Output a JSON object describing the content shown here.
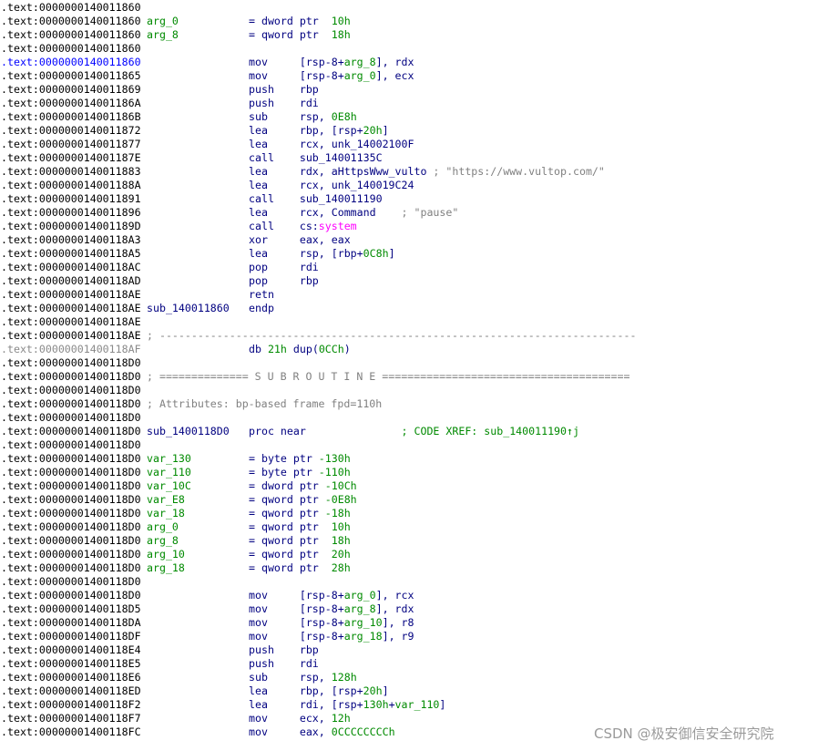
{
  "colors": {
    "x": "#000000",
    "b": "#0000ff",
    "g": "#8a8a8a",
    "k": "#000080",
    "n": "#008a00",
    "c": "#808080",
    "m": "#ff00ff"
  },
  "lines": [
    {
      "a": ".text:0000000140011860",
      "ac": "x",
      "label": [],
      "code": []
    },
    {
      "a": ".text:0000000140011860",
      "ac": "x",
      "label": [
        [
          "arg_0",
          "n"
        ]
      ],
      "code": [
        [
          "= dword ptr  ",
          "k"
        ],
        [
          "10h",
          "n"
        ]
      ]
    },
    {
      "a": ".text:0000000140011860",
      "ac": "x",
      "label": [
        [
          "arg_8",
          "n"
        ]
      ],
      "code": [
        [
          "= qword ptr  ",
          "k"
        ],
        [
          "18h",
          "n"
        ]
      ]
    },
    {
      "a": ".text:0000000140011860",
      "ac": "x",
      "label": [],
      "code": []
    },
    {
      "a": ".text:0000000140011860",
      "ac": "b",
      "label": [],
      "code": [
        [
          "mov     [rsp-8+",
          "k"
        ],
        [
          "arg_8",
          "n"
        ],
        [
          "], rdx",
          "k"
        ]
      ]
    },
    {
      "a": ".text:0000000140011865",
      "ac": "x",
      "label": [],
      "code": [
        [
          "mov     [rsp-8+",
          "k"
        ],
        [
          "arg_0",
          "n"
        ],
        [
          "], ecx",
          "k"
        ]
      ]
    },
    {
      "a": ".text:0000000140011869",
      "ac": "x",
      "label": [],
      "code": [
        [
          "push    rbp",
          "k"
        ]
      ]
    },
    {
      "a": ".text:000000014001186A",
      "ac": "x",
      "label": [],
      "code": [
        [
          "push    rdi",
          "k"
        ]
      ]
    },
    {
      "a": ".text:000000014001186B",
      "ac": "x",
      "label": [],
      "code": [
        [
          "sub     rsp, ",
          "k"
        ],
        [
          "0E8h",
          "n"
        ]
      ]
    },
    {
      "a": ".text:0000000140011872",
      "ac": "x",
      "label": [],
      "code": [
        [
          "lea     rbp, [rsp+",
          "k"
        ],
        [
          "20h",
          "n"
        ],
        [
          "]",
          "k"
        ]
      ]
    },
    {
      "a": ".text:0000000140011877",
      "ac": "x",
      "label": [],
      "code": [
        [
          "lea     rcx, unk_14002100F",
          "k"
        ]
      ]
    },
    {
      "a": ".text:000000014001187E",
      "ac": "x",
      "label": [],
      "code": [
        [
          "call    sub_14001135C",
          "k"
        ]
      ]
    },
    {
      "a": ".text:0000000140011883",
      "ac": "x",
      "label": [],
      "code": [
        [
          "lea     rdx, aHttpsWww_vulto ",
          "k"
        ],
        [
          "; \"https://www.vultop.com/\"",
          "c"
        ]
      ]
    },
    {
      "a": ".text:000000014001188A",
      "ac": "x",
      "label": [],
      "code": [
        [
          "lea     rcx, unk_140019C24",
          "k"
        ]
      ]
    },
    {
      "a": ".text:0000000140011891",
      "ac": "x",
      "label": [],
      "code": [
        [
          "call    sub_140011190",
          "k"
        ]
      ]
    },
    {
      "a": ".text:0000000140011896",
      "ac": "x",
      "label": [],
      "code": [
        [
          "lea     rcx, Command    ",
          "k"
        ],
        [
          "; \"pause\"",
          "c"
        ]
      ]
    },
    {
      "a": ".text:000000014001189D",
      "ac": "x",
      "label": [],
      "code": [
        [
          "call    cs:",
          "k"
        ],
        [
          "system",
          "m"
        ]
      ]
    },
    {
      "a": ".text:00000001400118A3",
      "ac": "x",
      "label": [],
      "code": [
        [
          "xor     eax, eax",
          "k"
        ]
      ]
    },
    {
      "a": ".text:00000001400118A5",
      "ac": "x",
      "label": [],
      "code": [
        [
          "lea     rsp, [rbp+",
          "k"
        ],
        [
          "0C8h",
          "n"
        ],
        [
          "]",
          "k"
        ]
      ]
    },
    {
      "a": ".text:00000001400118AC",
      "ac": "x",
      "label": [],
      "code": [
        [
          "pop     rdi",
          "k"
        ]
      ]
    },
    {
      "a": ".text:00000001400118AD",
      "ac": "x",
      "label": [],
      "code": [
        [
          "pop     rbp",
          "k"
        ]
      ]
    },
    {
      "a": ".text:00000001400118AE",
      "ac": "x",
      "label": [],
      "code": [
        [
          "retn",
          "k"
        ]
      ]
    },
    {
      "a": ".text:00000001400118AE",
      "ac": "x",
      "label": [
        [
          "sub_140011860",
          "k"
        ]
      ],
      "code": [
        [
          "endp",
          "k"
        ]
      ]
    },
    {
      "a": ".text:00000001400118AE",
      "ac": "x",
      "label": [],
      "code": []
    },
    {
      "a": ".text:00000001400118AE",
      "ac": "x",
      "label": [
        [
          "; ---------------------------------------------------------------------------",
          "c"
        ]
      ],
      "code": []
    },
    {
      "a": ".text:00000001400118AF",
      "ac": "g",
      "label": [],
      "code": [
        [
          "db ",
          "k"
        ],
        [
          "21h",
          "n"
        ],
        [
          " dup(",
          "k"
        ],
        [
          "0CCh",
          "n"
        ],
        [
          ")",
          "k"
        ]
      ]
    },
    {
      "a": ".text:00000001400118D0",
      "ac": "x",
      "label": [],
      "code": []
    },
    {
      "a": ".text:00000001400118D0",
      "ac": "x",
      "label": [
        [
          "; ============== S U B R O U T I N E =======================================",
          "c"
        ]
      ],
      "code": []
    },
    {
      "a": ".text:00000001400118D0",
      "ac": "x",
      "label": [],
      "code": []
    },
    {
      "a": ".text:00000001400118D0",
      "ac": "x",
      "label": [
        [
          "; Attributes: bp-based frame fpd=110h",
          "c"
        ]
      ],
      "code": []
    },
    {
      "a": ".text:00000001400118D0",
      "ac": "x",
      "label": [],
      "code": []
    },
    {
      "a": ".text:00000001400118D0",
      "ac": "x",
      "label": [
        [
          "sub_1400118D0",
          "k"
        ]
      ],
      "code": [
        [
          "proc near               ",
          "k"
        ],
        [
          "; CODE XREF: sub_140011190↑j",
          "n"
        ]
      ]
    },
    {
      "a": ".text:00000001400118D0",
      "ac": "x",
      "label": [],
      "code": []
    },
    {
      "a": ".text:00000001400118D0",
      "ac": "x",
      "label": [
        [
          "var_130",
          "n"
        ]
      ],
      "code": [
        [
          "= byte ptr ",
          "k"
        ],
        [
          "-130h",
          "n"
        ]
      ]
    },
    {
      "a": ".text:00000001400118D0",
      "ac": "x",
      "label": [
        [
          "var_110",
          "n"
        ]
      ],
      "code": [
        [
          "= byte ptr ",
          "k"
        ],
        [
          "-110h",
          "n"
        ]
      ]
    },
    {
      "a": ".text:00000001400118D0",
      "ac": "x",
      "label": [
        [
          "var_10C",
          "n"
        ]
      ],
      "code": [
        [
          "= dword ptr ",
          "k"
        ],
        [
          "-10Ch",
          "n"
        ]
      ]
    },
    {
      "a": ".text:00000001400118D0",
      "ac": "x",
      "label": [
        [
          "var_E8",
          "n"
        ]
      ],
      "code": [
        [
          "= qword ptr ",
          "k"
        ],
        [
          "-0E8h",
          "n"
        ]
      ]
    },
    {
      "a": ".text:00000001400118D0",
      "ac": "x",
      "label": [
        [
          "var_18",
          "n"
        ]
      ],
      "code": [
        [
          "= qword ptr ",
          "k"
        ],
        [
          "-18h",
          "n"
        ]
      ]
    },
    {
      "a": ".text:00000001400118D0",
      "ac": "x",
      "label": [
        [
          "arg_0",
          "n"
        ]
      ],
      "code": [
        [
          "= qword ptr  ",
          "k"
        ],
        [
          "10h",
          "n"
        ]
      ]
    },
    {
      "a": ".text:00000001400118D0",
      "ac": "x",
      "label": [
        [
          "arg_8",
          "n"
        ]
      ],
      "code": [
        [
          "= qword ptr  ",
          "k"
        ],
        [
          "18h",
          "n"
        ]
      ]
    },
    {
      "a": ".text:00000001400118D0",
      "ac": "x",
      "label": [
        [
          "arg_10",
          "n"
        ]
      ],
      "code": [
        [
          "= qword ptr  ",
          "k"
        ],
        [
          "20h",
          "n"
        ]
      ]
    },
    {
      "a": ".text:00000001400118D0",
      "ac": "x",
      "label": [
        [
          "arg_18",
          "n"
        ]
      ],
      "code": [
        [
          "= qword ptr  ",
          "k"
        ],
        [
          "28h",
          "n"
        ]
      ]
    },
    {
      "a": ".text:00000001400118D0",
      "ac": "x",
      "label": [],
      "code": []
    },
    {
      "a": ".text:00000001400118D0",
      "ac": "x",
      "label": [],
      "code": [
        [
          "mov     [rsp-8+",
          "k"
        ],
        [
          "arg_0",
          "n"
        ],
        [
          "], rcx",
          "k"
        ]
      ]
    },
    {
      "a": ".text:00000001400118D5",
      "ac": "x",
      "label": [],
      "code": [
        [
          "mov     [rsp-8+",
          "k"
        ],
        [
          "arg_8",
          "n"
        ],
        [
          "], rdx",
          "k"
        ]
      ]
    },
    {
      "a": ".text:00000001400118DA",
      "ac": "x",
      "label": [],
      "code": [
        [
          "mov     [rsp-8+",
          "k"
        ],
        [
          "arg_10",
          "n"
        ],
        [
          "], r8",
          "k"
        ]
      ]
    },
    {
      "a": ".text:00000001400118DF",
      "ac": "x",
      "label": [],
      "code": [
        [
          "mov     [rsp-8+",
          "k"
        ],
        [
          "arg_18",
          "n"
        ],
        [
          "], r9",
          "k"
        ]
      ]
    },
    {
      "a": ".text:00000001400118E4",
      "ac": "x",
      "label": [],
      "code": [
        [
          "push    rbp",
          "k"
        ]
      ]
    },
    {
      "a": ".text:00000001400118E5",
      "ac": "x",
      "label": [],
      "code": [
        [
          "push    rdi",
          "k"
        ]
      ]
    },
    {
      "a": ".text:00000001400118E6",
      "ac": "x",
      "label": [],
      "code": [
        [
          "sub     rsp, ",
          "k"
        ],
        [
          "128h",
          "n"
        ]
      ]
    },
    {
      "a": ".text:00000001400118ED",
      "ac": "x",
      "label": [],
      "code": [
        [
          "lea     rbp, [rsp+",
          "k"
        ],
        [
          "20h",
          "n"
        ],
        [
          "]",
          "k"
        ]
      ]
    },
    {
      "a": ".text:00000001400118F2",
      "ac": "x",
      "label": [],
      "code": [
        [
          "lea     rdi, [rsp+",
          "k"
        ],
        [
          "130h",
          "n"
        ],
        [
          "+",
          "k"
        ],
        [
          "var_110",
          "n"
        ],
        [
          "]",
          "k"
        ]
      ]
    },
    {
      "a": ".text:00000001400118F7",
      "ac": "x",
      "label": [],
      "code": [
        [
          "mov     ecx, ",
          "k"
        ],
        [
          "12h",
          "n"
        ]
      ]
    },
    {
      "a": ".text:00000001400118FC",
      "ac": "x",
      "label": [],
      "code": [
        [
          "mov     eax, ",
          "k"
        ],
        [
          "0CCCCCCCCh",
          "n"
        ]
      ]
    }
  ],
  "watermark": "CSDN @极安御信安全研究院"
}
